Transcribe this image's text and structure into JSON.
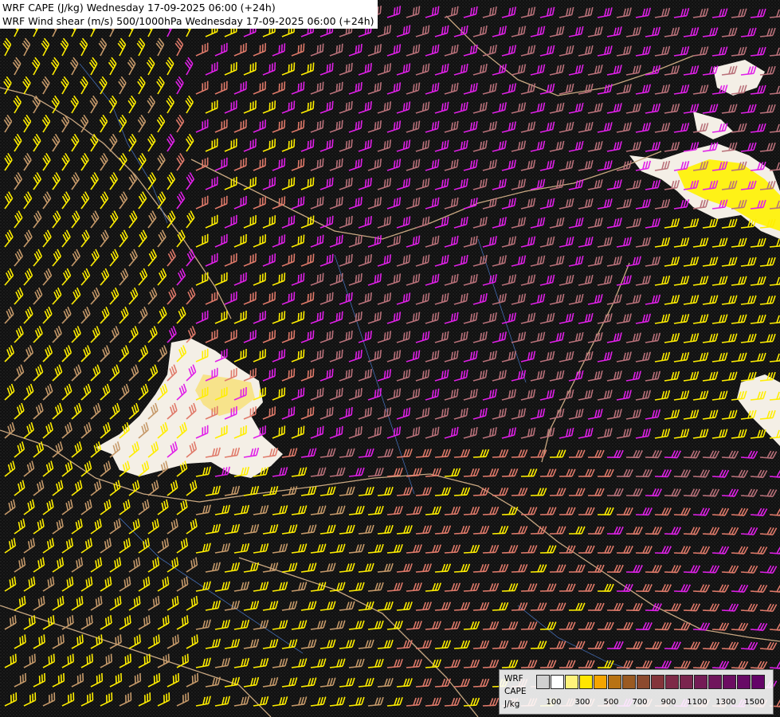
{
  "titles": {
    "line1": "WRF CAPE (J/kg) Wednesday 17-09-2025 06:00 (+24h)",
    "line2": "WRF Wind shear (m/s) 500/1000hPa Wednesday 17-09-2025 06:00 (+24h)"
  },
  "legend": {
    "label1": "WRF",
    "label2": "CAPE",
    "label3": "J/kg",
    "colors": [
      "#d0d0d0",
      "#ffffff",
      "#fff27a",
      "#ffe600",
      "#f5a500",
      "#b87314",
      "#9a5a22",
      "#8c4a2e",
      "#84343a",
      "#7e2a48",
      "#7a244e",
      "#741c56",
      "#70155c",
      "#6c0e62",
      "#680a66",
      "#640468"
    ],
    "ticks": [
      "100",
      "300",
      "500",
      "700",
      "900",
      "1100",
      "1300",
      "1500"
    ]
  },
  "map_data": {
    "field_background": "#141414",
    "barb_colors": {
      "yellow": "#ffee00",
      "tan": "#c69a6a",
      "salmon": "#e07a6a",
      "dusty_rose": "#b9717a",
      "magenta": "#e020e8"
    },
    "cape_area_color": "#f4efe6",
    "cape_core_color": "#f7e07a",
    "border_color": "#c9a882",
    "river_color": "#4a78c8"
  }
}
